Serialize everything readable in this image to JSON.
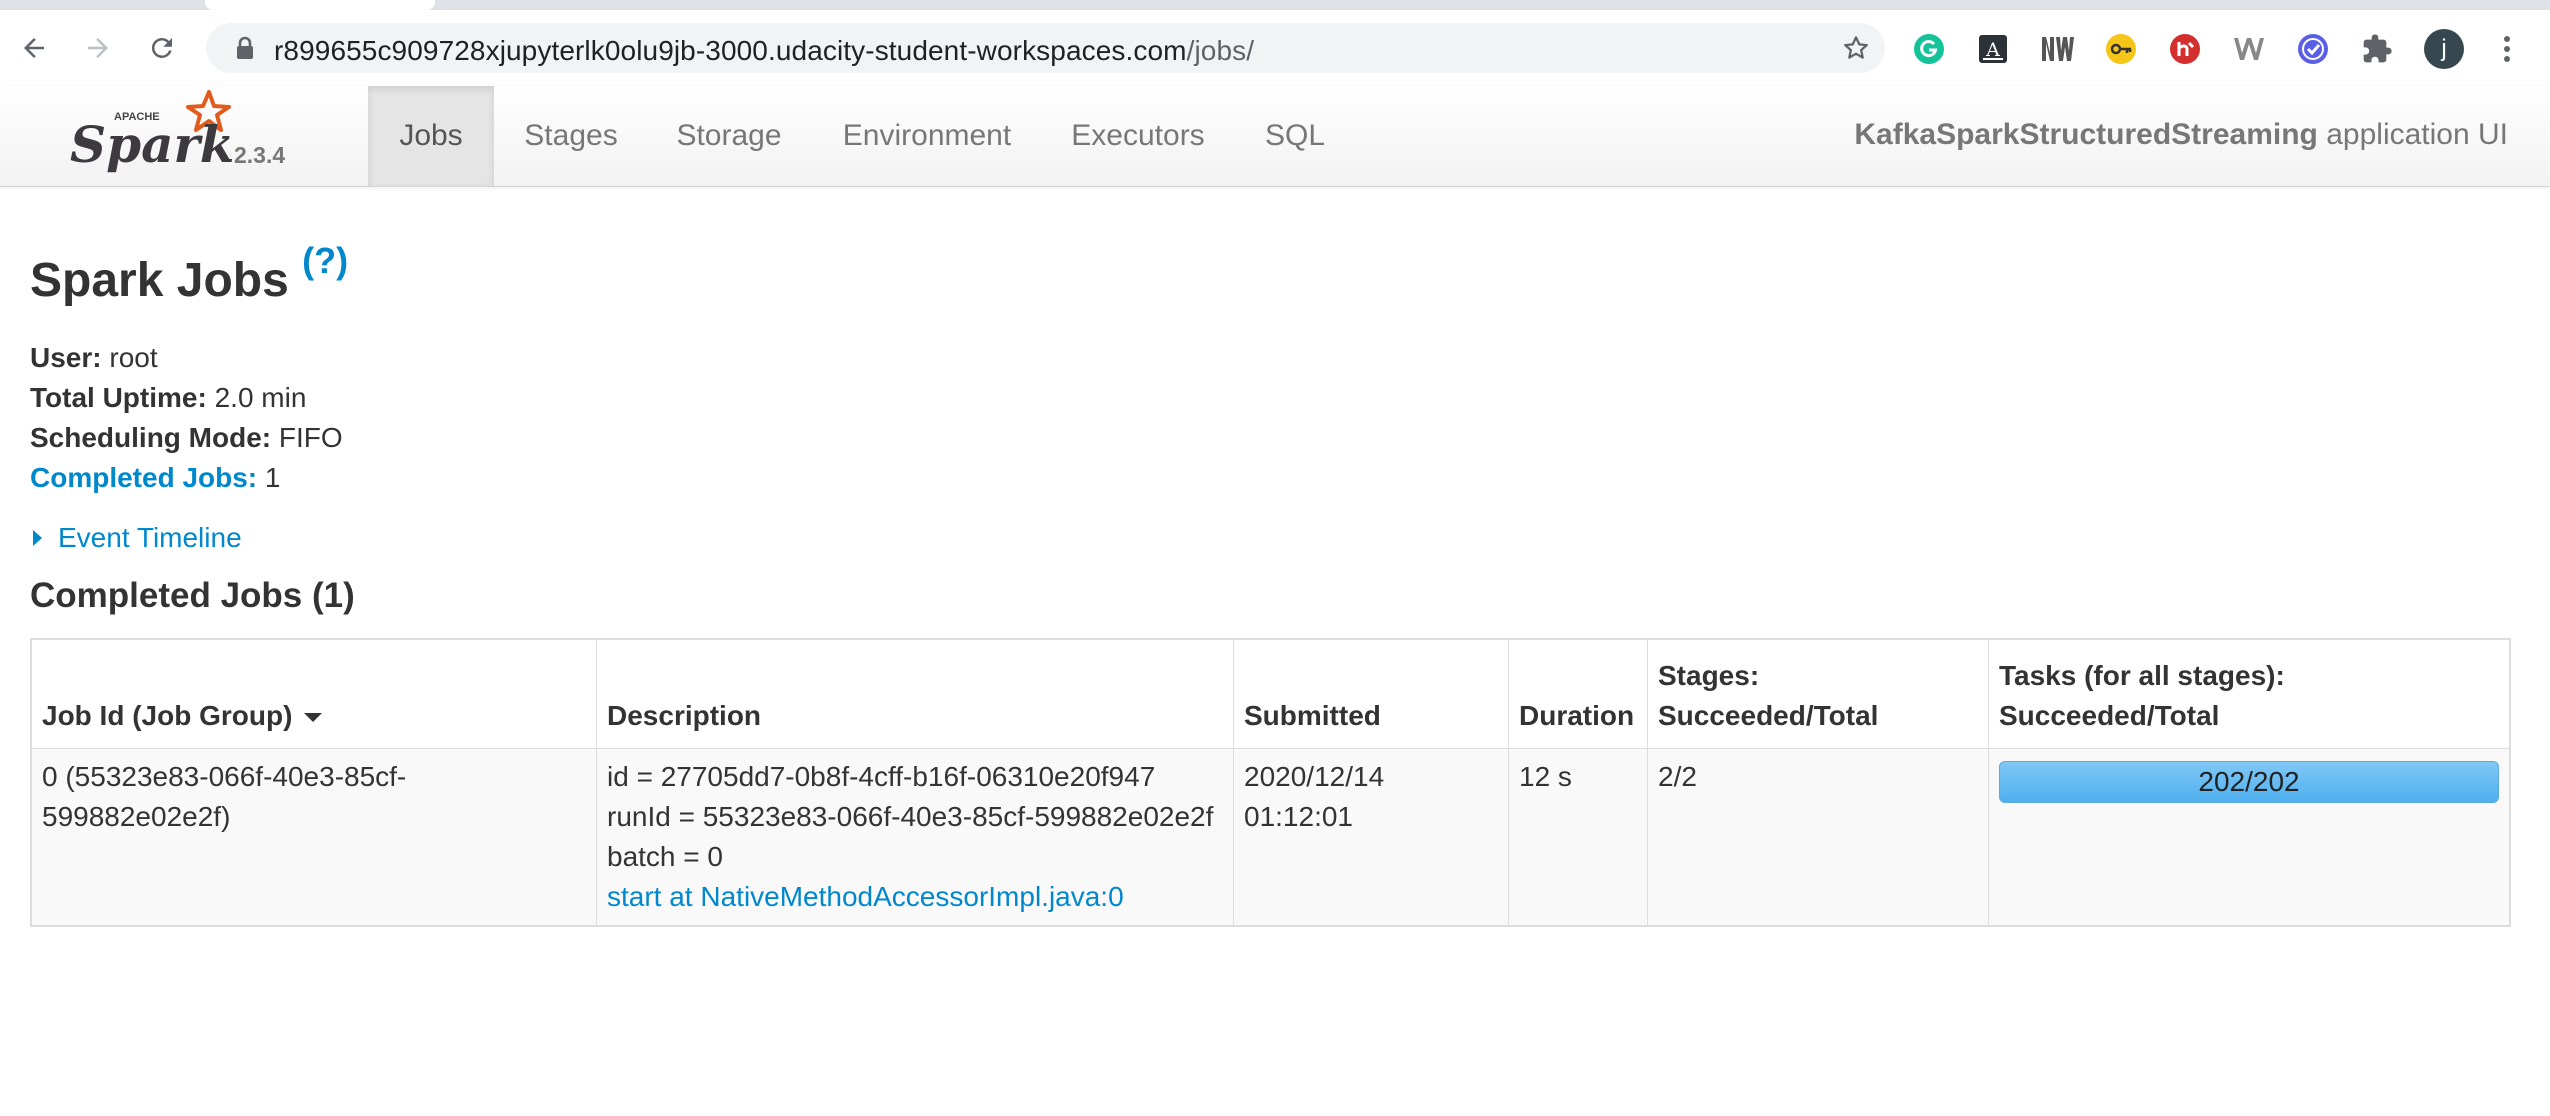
{
  "browser": {
    "url_host": "r899655c909728xjupyterlk0olu9jb-3000.udacity-student-workspaces.com",
    "url_path": "/jobs/",
    "profile_initial": "j",
    "icons": [
      "back-icon",
      "forward-icon",
      "reload-icon",
      "lock-icon",
      "star-icon",
      "grammarly-icon",
      "ext-a-icon",
      "ext-wn-icon",
      "ext-key-icon",
      "ext-red-icon",
      "ext-w-icon",
      "ext-check-icon",
      "puzzle-icon",
      "more-icon"
    ],
    "accent_colors": {
      "grammarly": "#15c39a",
      "red_ext": "#d32f2f",
      "check_ext": "#5b5fe8"
    }
  },
  "spark": {
    "brand_small": "APACHE",
    "brand": "Spark",
    "version": "2.3.4",
    "tabs": [
      {
        "label": "Jobs",
        "active": true
      },
      {
        "label": "Stages",
        "active": false
      },
      {
        "label": "Storage",
        "active": false
      },
      {
        "label": "Environment",
        "active": false
      },
      {
        "label": "Executors",
        "active": false
      },
      {
        "label": "SQL",
        "active": false
      }
    ],
    "app_name": "KafkaSparkStructuredStreaming",
    "app_suffix": "application UI"
  },
  "page": {
    "title": "Spark Jobs",
    "help": "(?)",
    "summary": {
      "user_label": "User:",
      "user": "root",
      "uptime_label": "Total Uptime:",
      "uptime": "2.0 min",
      "mode_label": "Scheduling Mode:",
      "mode": "FIFO",
      "completed_label": "Completed Jobs:",
      "completed": "1"
    },
    "event_timeline": "Event Timeline",
    "section_title": "Completed Jobs (1)"
  },
  "table": {
    "headers": {
      "job_id": "Job Id (Job Group)",
      "description": "Description",
      "submitted": "Submitted",
      "duration": "Duration",
      "stages_1": "Stages:",
      "stages_2": "Succeeded/Total",
      "tasks_1": "Tasks (for all stages):",
      "tasks_2": "Succeeded/Total"
    },
    "rows": [
      {
        "job_id_1": "0 (55323e83-066f-40e3-85cf-",
        "job_id_2": "599882e02e2f)",
        "desc_1": "id = 27705dd7-0b8f-4cff-b16f-06310e20f947",
        "desc_2": "runId = 55323e83-066f-40e3-85cf-599882e02e2f",
        "desc_3": "batch = 0",
        "desc_link": "start at NativeMethodAccessorImpl.java:0",
        "submitted_1": "2020/12/14",
        "submitted_2": "01:12:01",
        "duration": "12 s",
        "stages": "2/2",
        "tasks": "202/202",
        "tasks_fraction": 1.0
      }
    ]
  },
  "colors": {
    "link": "#0088cc",
    "progress": "#5cb3f0"
  }
}
